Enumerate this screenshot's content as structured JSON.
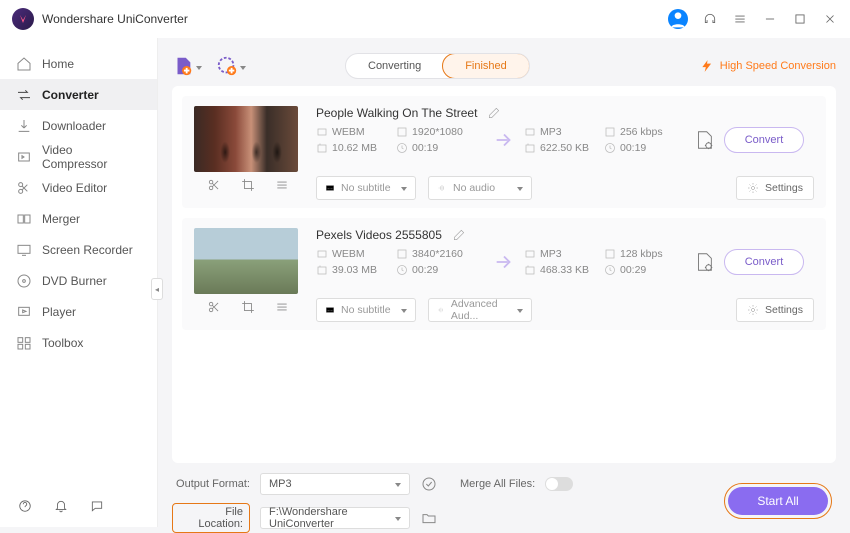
{
  "app": {
    "title": "Wondershare UniConverter"
  },
  "sidebar": {
    "items": [
      {
        "label": "Home"
      },
      {
        "label": "Converter"
      },
      {
        "label": "Downloader"
      },
      {
        "label": "Video Compressor"
      },
      {
        "label": "Video Editor"
      },
      {
        "label": "Merger"
      },
      {
        "label": "Screen Recorder"
      },
      {
        "label": "DVD Burner"
      },
      {
        "label": "Player"
      },
      {
        "label": "Toolbox"
      }
    ]
  },
  "tabs": {
    "converting": "Converting",
    "finished": "Finished"
  },
  "hsc": "High Speed Conversion",
  "files": [
    {
      "title": "People Walking On The Street",
      "src": {
        "fmt": "WEBM",
        "res": "1920*1080",
        "size": "10.62 MB",
        "dur": "00:19"
      },
      "dst": {
        "fmt": "MP3",
        "br": "256 kbps",
        "size": "622.50 KB",
        "dur": "00:19"
      },
      "subtitle": "No subtitle",
      "audio": "No audio",
      "settings": "Settings",
      "convert": "Convert"
    },
    {
      "title": "Pexels Videos 2555805",
      "src": {
        "fmt": "WEBM",
        "res": "3840*2160",
        "size": "39.03 MB",
        "dur": "00:29"
      },
      "dst": {
        "fmt": "MP3",
        "br": "128 kbps",
        "size": "468.33 KB",
        "dur": "00:29"
      },
      "subtitle": "No subtitle",
      "audio": "Advanced Aud...",
      "settings": "Settings",
      "convert": "Convert"
    }
  ],
  "footer": {
    "output_format_label": "Output Format:",
    "output_format_value": "MP3",
    "merge_label": "Merge All Files:",
    "file_location_label": "File Location:",
    "file_location_value": "F:\\Wondershare UniConverter",
    "start_all": "Start All"
  }
}
